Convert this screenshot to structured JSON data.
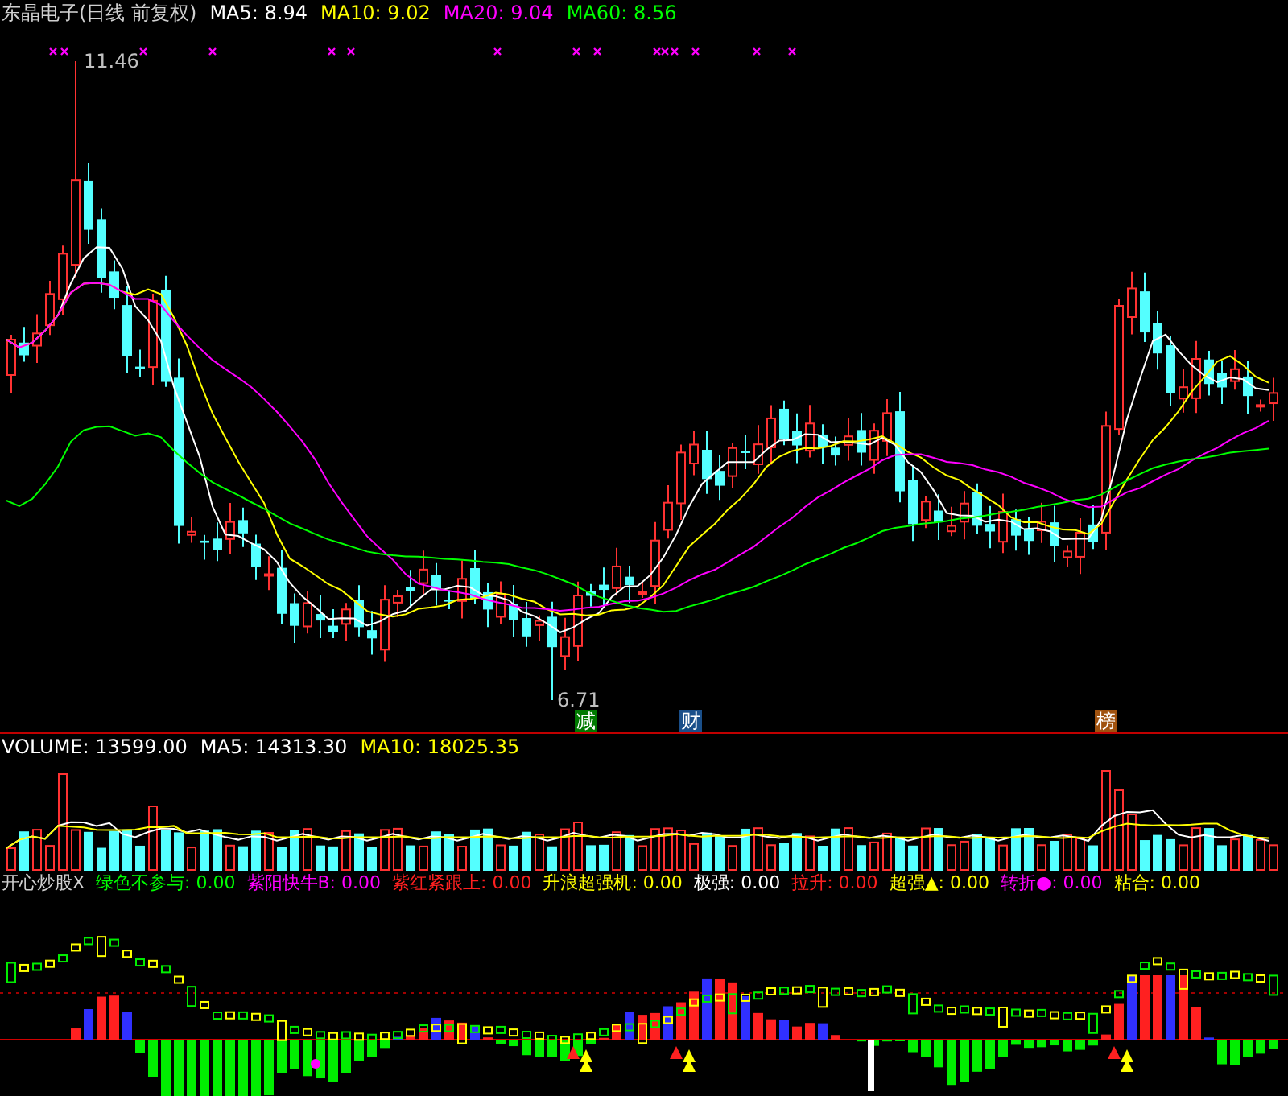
{
  "price_header": {
    "title": "东晶电子(日线 前复权)",
    "indicators": [
      {
        "label": "MA5: 8.94",
        "color": "#ffffff"
      },
      {
        "label": "MA10: 9.02",
        "color": "#ffff00"
      },
      {
        "label": "MA20: 9.04",
        "color": "#ff00ff"
      },
      {
        "label": "MA60: 8.56",
        "color": "#00ff00"
      }
    ]
  },
  "price_chart": {
    "high_label": "11.46",
    "low_label": "6.71",
    "events": [
      {
        "text": "减",
        "color": "#007a00"
      },
      {
        "text": "财",
        "color": "#1a4f8a"
      },
      {
        "text": "榜",
        "color": "#a0520f"
      }
    ]
  },
  "volume_header": {
    "indicators": [
      {
        "label": "VOLUME: 13599.00",
        "color": "#ffffff"
      },
      {
        "label": "MA5: 14313.30",
        "color": "#ffffff"
      },
      {
        "label": "MA10: 18025.35",
        "color": "#ffff00"
      }
    ]
  },
  "indicator_header": {
    "title": "开心炒股X",
    "indicators": [
      {
        "label": "绿色不参与: 0.00",
        "color": "#00ff00"
      },
      {
        "label": "紫阳快牛B: 0.00",
        "color": "#ff00ff"
      },
      {
        "label": "紫红紧跟上: 0.00",
        "color": "#ff2020"
      },
      {
        "label": "升浪超强机: 0.00",
        "color": "#ffff00"
      },
      {
        "label": "极强: 0.00",
        "color": "#ffffff"
      },
      {
        "label": "拉升: 0.00",
        "color": "#ff2020"
      },
      {
        "label": "超强▲: 0.00",
        "color": "#ffff00"
      },
      {
        "label": "转折●: 0.00",
        "color": "#ff00ff"
      },
      {
        "label": "粘合: 0.00",
        "color": "#ffff00"
      }
    ]
  }
}
